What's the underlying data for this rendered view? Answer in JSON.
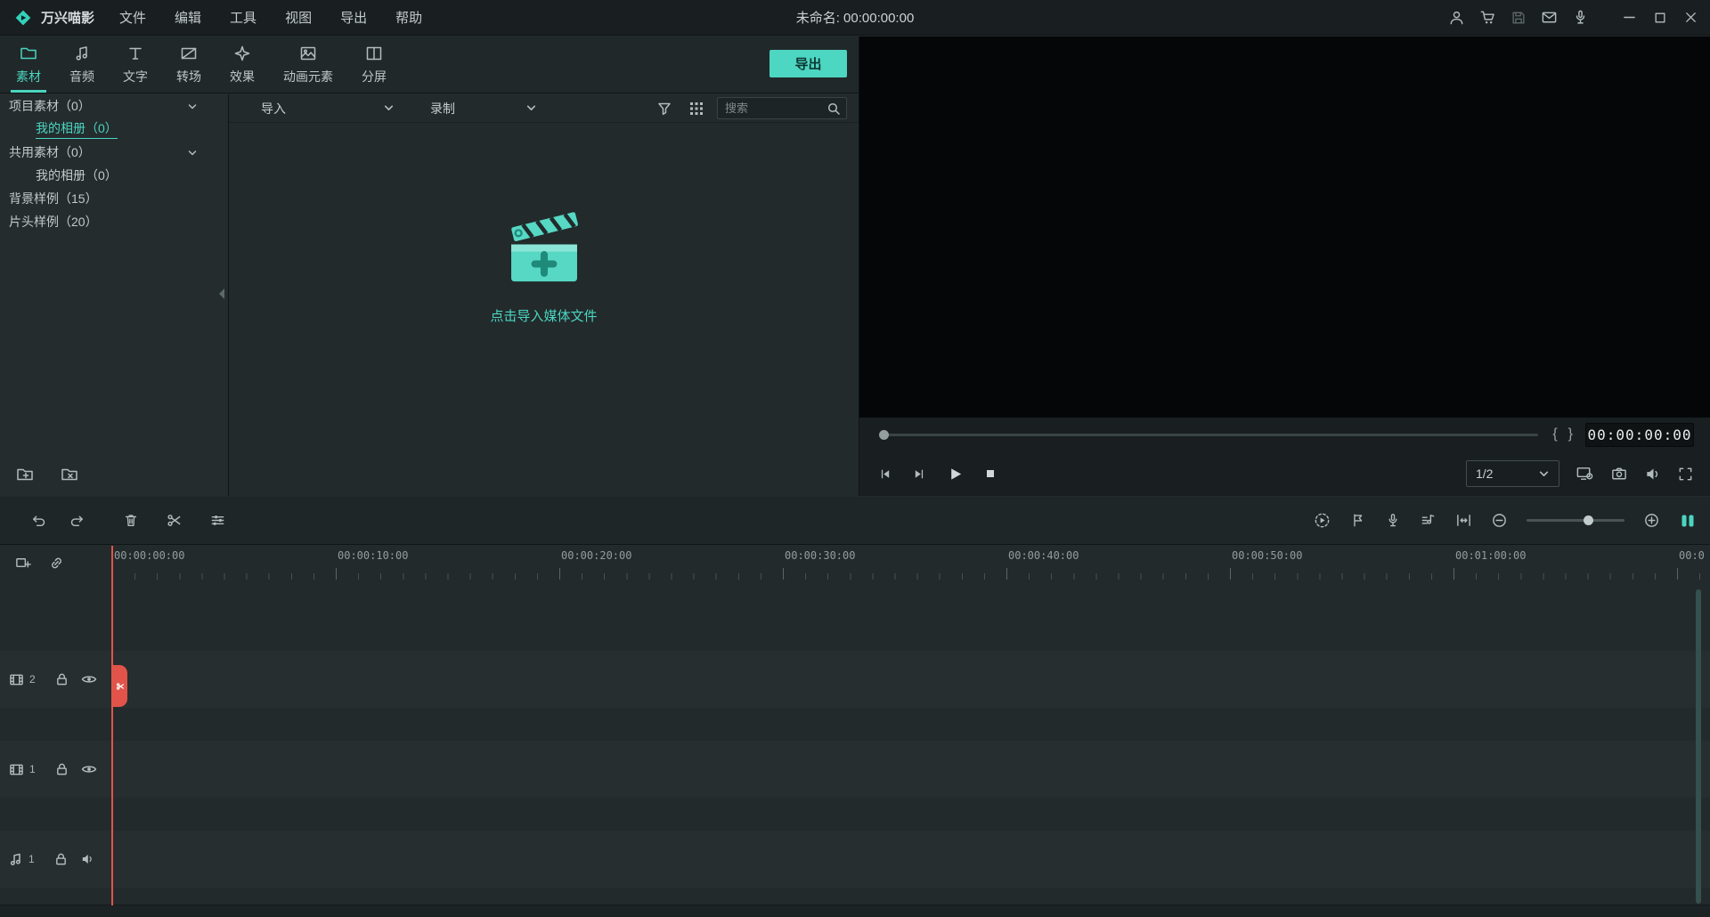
{
  "titlebar": {
    "app_name": "万兴喵影",
    "menus": [
      "文件",
      "编辑",
      "工具",
      "视图",
      "导出",
      "帮助"
    ],
    "project_title": "未命名: 00:00:00:00"
  },
  "topbar": {
    "tabs": [
      "素材",
      "音频",
      "文字",
      "转场",
      "效果",
      "动画元素",
      "分屏"
    ],
    "export_label": "导出"
  },
  "sidebar": {
    "items": [
      {
        "label": "项目素材（0）",
        "expandable": true,
        "active": false
      },
      {
        "label": "我的相册（0）",
        "expandable": false,
        "active": true
      },
      {
        "label": "共用素材（0）",
        "expandable": true,
        "active": false
      },
      {
        "label": "我的相册（0）",
        "expandable": false,
        "active": false
      },
      {
        "label": "背景样例（15）",
        "expandable": false,
        "active": false
      },
      {
        "label": "片头样例（20）",
        "expandable": false,
        "active": false
      }
    ]
  },
  "media_panel": {
    "import_label": "导入",
    "record_label": "录制",
    "search_placeholder": "搜索",
    "empty_text": "点击导入媒体文件"
  },
  "preview": {
    "timecode": "00:00:00:00",
    "zoom_selected": "1/2"
  },
  "timeline": {
    "ruler_labels": [
      "00:00:00:00",
      "00:00:10:00",
      "00:00:20:00",
      "00:00:30:00",
      "00:00:40:00",
      "00:00:50:00",
      "00:01:00:00",
      "00:0"
    ],
    "tracks": [
      {
        "kind": "video",
        "number": "2"
      },
      {
        "kind": "video",
        "number": "1"
      },
      {
        "kind": "audio",
        "number": "1"
      }
    ]
  },
  "glyphs": {
    "bracket_in": "{",
    "bracket_out": "}"
  },
  "colors": {
    "accent": "#4bd5c0",
    "playhead": "#e25449",
    "export_button_bg": "#4dd6c1"
  }
}
